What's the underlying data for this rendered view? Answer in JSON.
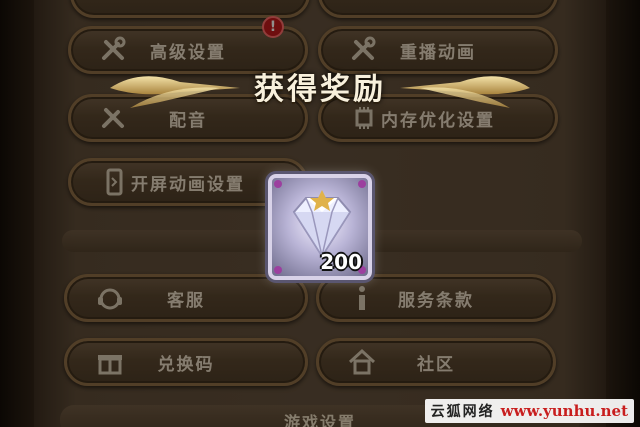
{
  "settings_menu": {
    "advanced_settings": "高级设置",
    "replay_animation": "重播动画",
    "voice": "配音",
    "memory_optimization": "内存优化设置",
    "splash_animation": "开屏动画设置",
    "customer_service": "客服",
    "terms_of_service": "服务条款",
    "redeem_code": "兑换码",
    "community": "社区",
    "game_settings": "游戏设置",
    "alert_badge": "!"
  },
  "reward_popup": {
    "title": "获得奖励",
    "item_icon": "diamond-icon",
    "item_quantity": "200"
  },
  "watermark": {
    "site_name": "云狐网络",
    "url": "www.yunhu.net"
  },
  "colors": {
    "button_fill": "#55442f",
    "button_border": "#8a6c46",
    "badge_red": "#c0141a",
    "watermark_red": "#c81e1e"
  }
}
